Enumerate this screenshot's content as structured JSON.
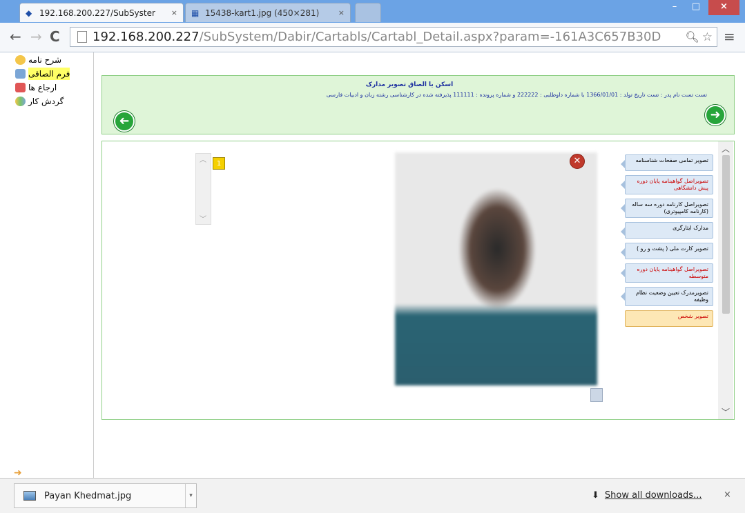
{
  "browser": {
    "tabs": [
      {
        "label": "192.168.200.227/SubSyster",
        "close": "×"
      },
      {
        "label": "15438-kart1.jpg (450×281)",
        "close": "×"
      }
    ],
    "window_controls": {
      "minimize": "–",
      "maximize": "□",
      "close": "×"
    },
    "nav": {
      "back": "←",
      "forward": "→",
      "reload": "C"
    },
    "address": {
      "host": "192.168.200.227",
      "path": "/SubSystem/Dabir/Cartabls/Cartabl_Detail.aspx?param=-161A3C657B30D"
    },
    "menu": "≡"
  },
  "sidebar": {
    "items": [
      {
        "label": "شرح نامه",
        "icon": "mail-icon"
      },
      {
        "label": "فرم الصاقی",
        "icon": "form-icon",
        "highlighted": true
      },
      {
        "label": "ارجاع ها",
        "icon": "referral-icon"
      },
      {
        "label": "گردش کار",
        "icon": "workflow-icon"
      }
    ]
  },
  "header": {
    "title": "اسکن یا الصاق تصویر مدارک",
    "description": "تست تست نام پدر : تست تاریخ تولد : 1366/01/01 با شماره داوطلبی : 222222 و شماره پرونده : 111111 پذیرفته شده در کارشناسی رشته زبان و ادبیات فارسی"
  },
  "viewer": {
    "thumb_number": "1",
    "documents": [
      {
        "label": "تصویر تمامی صفحات شناسنامه",
        "color": "#000000"
      },
      {
        "label": "تصویراصل گواهینامه پایان دوره پیش دانشگاهی",
        "color": "#cc0000"
      },
      {
        "label": "تصویراصل کارنامه دوره سه ساله (کارنامه کامپیوتری)",
        "color": "#000000"
      },
      {
        "label": "مدارک ایثارگری",
        "color": "#000000"
      },
      {
        "label": "تصویر کارت ملی ( پشت و رو )",
        "color": "#000000"
      },
      {
        "label": "تصویراصل گواهینامه پایان دوره متوسطه",
        "color": "#cc0000"
      },
      {
        "label": "تصویرمدرک تعیین وضعیت نظام وظیفه",
        "color": "#000000"
      },
      {
        "label": "تصویر شخص",
        "color": "#cc0000",
        "selected": true
      }
    ]
  },
  "downloads": {
    "file_name": "Payan Khedmat.jpg",
    "show_all": "Show all downloads...",
    "close": "×"
  }
}
